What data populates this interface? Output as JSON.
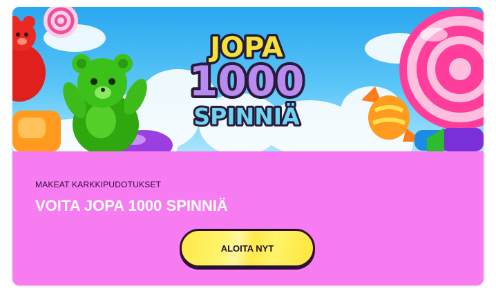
{
  "banner": {
    "logo_line1": "JOPA",
    "logo_line2": "1000",
    "logo_line3": "SPINNIÄ"
  },
  "promo": {
    "subtitle": "MAKEAT KARKKIPUDOTUKSET",
    "headline": "VOITA JOPA 1000 SPINNIÄ",
    "cta_label": "ALOITA NYT"
  },
  "colors": {
    "card_background": "#f77cf2",
    "cta_background": "#ffe94a",
    "headline_text": "#ffffff"
  },
  "icons": [
    "gummy-bear-red-icon",
    "gummy-bear-green-icon",
    "lollipop-icon",
    "wrapped-candy-icon"
  ]
}
